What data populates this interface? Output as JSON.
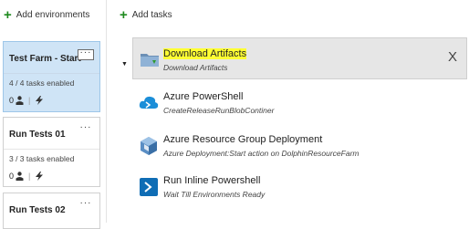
{
  "left_panel": {
    "add_environments_label": "Add environments",
    "environments": [
      {
        "title": "Test Farm - Start",
        "tasks_enabled": "4 / 4 tasks enabled",
        "approvers": "0",
        "selected": true
      },
      {
        "title": "Run Tests 01",
        "tasks_enabled": "3 / 3 tasks enabled",
        "approvers": "0",
        "selected": false
      },
      {
        "title": "Run Tests 02",
        "selected": false
      }
    ],
    "more_label": "···"
  },
  "main_panel": {
    "add_tasks_label": "Add tasks",
    "close_label": "X",
    "tasks": [
      {
        "name": "Download Artifacts",
        "subtitle": "Download Artifacts",
        "icon": "folder-download-icon",
        "selected": true
      },
      {
        "name": "Azure PowerShell",
        "subtitle": "CreateReleaseRunBlobContiner",
        "icon": "azure-cloud-powershell-icon"
      },
      {
        "name": "Azure Resource Group Deployment",
        "subtitle": "Azure Deployment:Start action on DolphinResourceFarm",
        "icon": "cube-icon"
      },
      {
        "name": "Run Inline Powershell",
        "subtitle": "Wait Till Environments Ready",
        "icon": "powershell-icon"
      }
    ]
  },
  "colors": {
    "accent_green": "#1e8a1e",
    "selected_card": "#cfe4f6",
    "highlight": "#ffff33",
    "azure_blue": "#1b8ed8"
  }
}
